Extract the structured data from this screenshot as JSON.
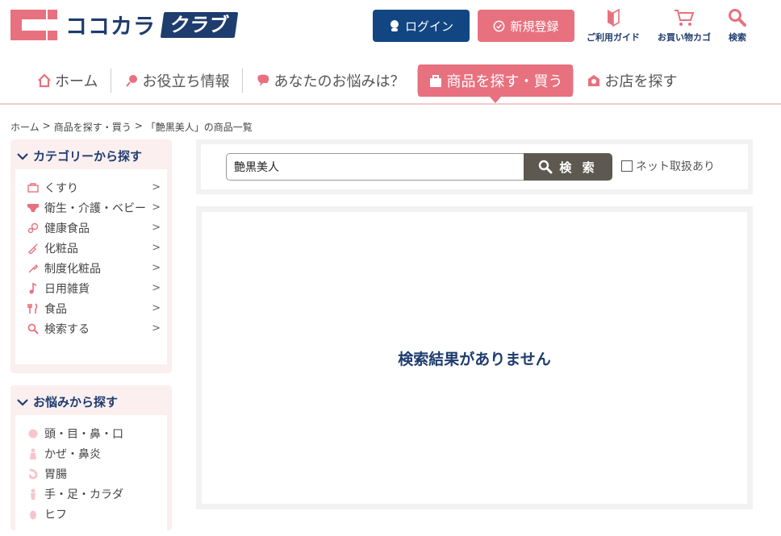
{
  "header": {
    "logo_text": "ココカラ",
    "logo_badge": "クラブ",
    "login_label": "ログイン",
    "register_label": "新規登録",
    "guide_label": "ご利用ガイド",
    "cart_label": "お買い物カゴ",
    "search_label": "検索"
  },
  "nav": {
    "items": [
      {
        "label": "ホーム"
      },
      {
        "label": "お役立ち情報"
      },
      {
        "label": "あなたのお悩みは？"
      },
      {
        "label": "商品を探す・買う"
      },
      {
        "label": "お店を探す"
      }
    ]
  },
  "breadcrumb": {
    "items": [
      "ホーム",
      "商品を探す・買う",
      "「艶黒美人」の商品一覧"
    ],
    "separator": ">"
  },
  "sidebar": {
    "category_title": "カテゴリーから探す",
    "categories": [
      {
        "label": "くすり"
      },
      {
        "label": "衛生・介護・ベビー"
      },
      {
        "label": "健康食品"
      },
      {
        "label": "化粧品"
      },
      {
        "label": "制度化粧品"
      },
      {
        "label": "日用雑貨"
      },
      {
        "label": "食品"
      },
      {
        "label": "検索する"
      }
    ],
    "concern_title": "お悩みから探す",
    "concerns": [
      {
        "label": "頭・目・鼻・口"
      },
      {
        "label": "かぜ・鼻炎"
      },
      {
        "label": "胃腸"
      },
      {
        "label": "手・足・カラダ"
      },
      {
        "label": "ヒフ"
      }
    ]
  },
  "search": {
    "value": "艶黒美人",
    "button_label": "検 索",
    "net_checkbox_label": "ネット取扱あり"
  },
  "results": {
    "empty_message": "検索結果がありません"
  },
  "colors": {
    "brand_pink": "#e8717f",
    "brand_navy": "#1e3c6e",
    "login_blue": "#114682",
    "search_btn": "#5d5950"
  }
}
